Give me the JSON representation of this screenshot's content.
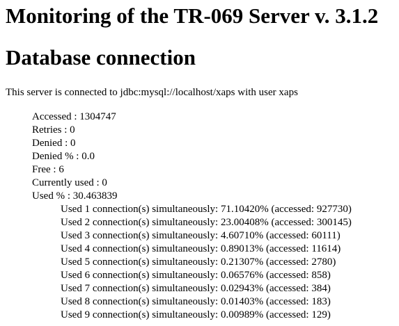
{
  "header": {
    "title": "Monitoring of the TR-069 Server v. 3.1.2",
    "section_title": "Database connection"
  },
  "intro": "This server is connected to jdbc:mysql://localhost/xaps with user xaps",
  "stats": [
    "Accessed : 1304747",
    "Retries : 0",
    "Denied : 0",
    "Denied % : 0.0",
    "Free : 6",
    "Currently used : 0",
    "Used % : 30.463839"
  ],
  "usage": [
    "Used 1 connection(s) simultaneously: 71.10420% (accessed: 927730)",
    "Used 2 connection(s) simultaneously: 23.00408% (accessed: 300145)",
    "Used 3 connection(s) simultaneously: 4.60710% (accessed: 60111)",
    "Used 4 connection(s) simultaneously: 0.89013% (accessed: 11614)",
    "Used 5 connection(s) simultaneously: 0.21307% (accessed: 2780)",
    "Used 6 connection(s) simultaneously: 0.06576% (accessed: 858)",
    "Used 7 connection(s) simultaneously: 0.02943% (accessed: 384)",
    "Used 8 connection(s) simultaneously: 0.01403% (accessed: 183)",
    "Used 9 connection(s) simultaneously: 0.00989% (accessed: 129)"
  ]
}
